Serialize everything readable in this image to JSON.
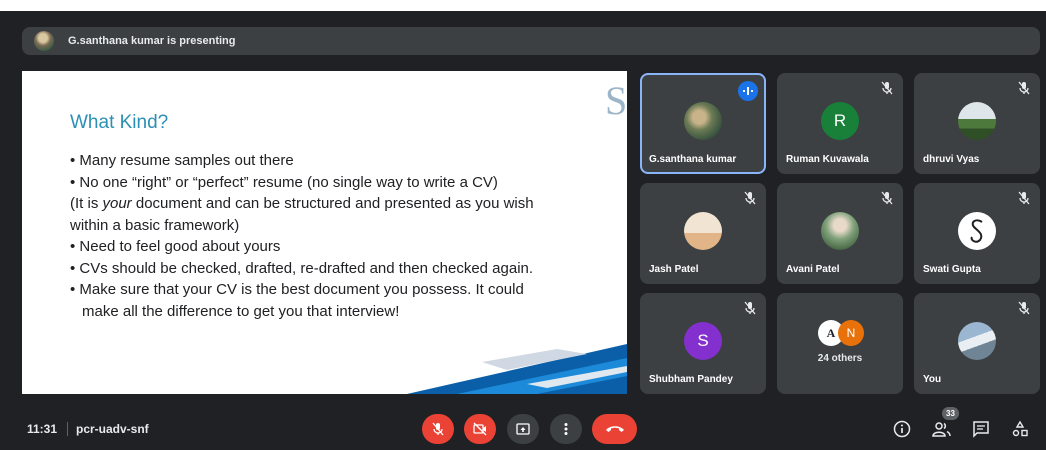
{
  "presenting": {
    "text": "G.santhana kumar is presenting"
  },
  "slide": {
    "title": "What Kind?",
    "lines": [
      "Many resume samples out there",
      "No one “right” or “perfect” resume (no single way to write a CV)",
      "(It is your document and can be structured and presented as you wish",
      "within a basic framework)",
      "Need to feel good about yours",
      "CVs should be checked, drafted, re-drafted and then checked again.",
      "Make sure that your CV is the best document you possess.  It could",
      "make all the difference to get you that interview!"
    ]
  },
  "participants": [
    {
      "name": "G.santhana kumar",
      "avatar": "photo",
      "speaking": true
    },
    {
      "name": "Ruman Kuvawala",
      "avatar": "R",
      "color": "#188038",
      "muted": true
    },
    {
      "name": "dhruvi Vyas",
      "avatar": "photo",
      "muted": true
    },
    {
      "name": "Jash Patel",
      "avatar": "photo",
      "muted": true
    },
    {
      "name": "Avani Patel",
      "avatar": "photo",
      "muted": true
    },
    {
      "name": "Swati Gupta",
      "avatar": "S-script",
      "muted": true
    },
    {
      "name": "Shubham Pandey",
      "avatar": "S",
      "color": "#8430ce",
      "muted": true
    },
    {
      "name": "24 others",
      "avatars": [
        "A",
        "N"
      ],
      "colors": [
        "#ffffff",
        "#e8710a"
      ]
    },
    {
      "name": "You",
      "avatar": "photo",
      "muted": true
    }
  ],
  "bottom": {
    "time": "11:31",
    "separator": "|",
    "meeting_code": "pcr-uadv-snf",
    "people_count": "33"
  },
  "controls": [
    "mic-off",
    "camera-off",
    "present",
    "more-options",
    "leave-call"
  ],
  "right_icons": [
    "info",
    "people",
    "chat",
    "activities"
  ],
  "colors": {
    "accent": "#1a73e8",
    "danger": "#ea4335",
    "tile": "#3c4043",
    "bg": "#202124",
    "slide_title": "#2c8fb5"
  }
}
